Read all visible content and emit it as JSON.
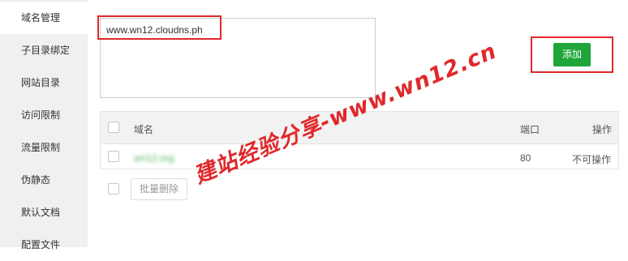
{
  "sidebar": {
    "items": [
      {
        "label": "域名管理",
        "active": true
      },
      {
        "label": "子目录绑定"
      },
      {
        "label": "网站目录"
      },
      {
        "label": "访问限制"
      },
      {
        "label": "流量限制"
      },
      {
        "label": "伪静态"
      },
      {
        "label": "默认文档"
      },
      {
        "label": "配置文件"
      }
    ]
  },
  "domain_input": {
    "value": "www.wn12.cloudns.ph"
  },
  "add_button": {
    "label": "添加",
    "color": "#20a53a"
  },
  "table": {
    "headers": {
      "domain": "域名",
      "port": "端口",
      "action": "操作"
    },
    "rows": [
      {
        "domain": "wn12.org",
        "domain_blurred": true,
        "port": "80",
        "action": "不可操作"
      }
    ]
  },
  "batch_delete_label": "批量删除",
  "watermark": {
    "text": "建站经验分享-www.wn12.cn",
    "color": "#e0282b"
  },
  "highlight_color": "#e0282b"
}
